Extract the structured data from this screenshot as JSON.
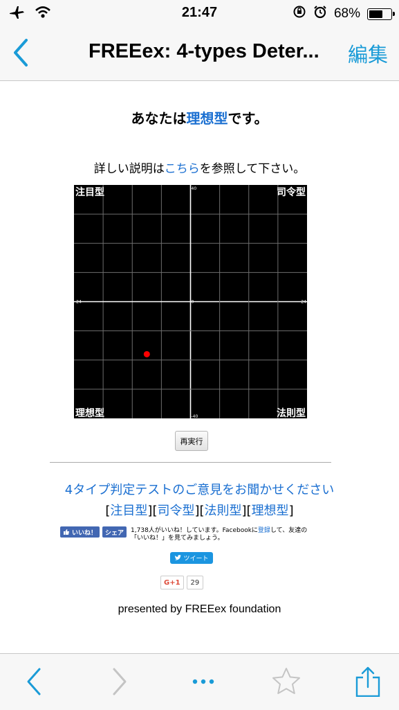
{
  "status_bar": {
    "time": "21:47",
    "battery_percent": "68%",
    "battery_level": 0.68,
    "icons": [
      "airplane-icon",
      "wifi-icon",
      "rotation-lock-icon",
      "alarm-icon",
      "battery-icon"
    ]
  },
  "nav": {
    "title": "FREEex: 4-types Deter...",
    "edit_label": "編集",
    "accent_color": "#1a9bd7"
  },
  "result": {
    "prefix": "あなたは",
    "type": "理想型",
    "suffix": "です。"
  },
  "detail": {
    "prefix": "詳しい説明は",
    "link": "こちら",
    "suffix": "を参照して下さい。"
  },
  "chart_data": {
    "type": "scatter",
    "quadrant_labels": {
      "top_left": "注目型",
      "top_right": "司令型",
      "bottom_left": "理想型",
      "bottom_right": "法則型"
    },
    "x_range": [
      -24,
      24
    ],
    "y_range": [
      -40,
      40
    ],
    "tick_labels": {
      "y_top": "40",
      "y_bottom": "-40",
      "x_left": "-24",
      "x_right": "24",
      "origin": "0"
    },
    "points": [
      {
        "x": -9,
        "y": -18,
        "color": "#ff0000"
      }
    ],
    "grid": true
  },
  "rerun_label": "再実行",
  "feedback_link": "4タイプ判定テストのご意見をお聞かせください",
  "type_links": [
    "注目型",
    "司令型",
    "法則型",
    "理想型"
  ],
  "social": {
    "like_label": "いいね！",
    "share_label": "シェア",
    "fb_text_1": "1,738人がいいね！しています。Facebookに",
    "fb_register": "登録",
    "fb_text_2": "して、友達の",
    "fb_text_3": "「いいね！」を見てみましょう。",
    "tweet_label": "ツイート",
    "gplus_label": "G+1",
    "gplus_count": "29"
  },
  "presented_by": "presented by FREEex foundation",
  "toolbar": {
    "icons": [
      "back-icon",
      "forward-icon",
      "more-icon",
      "favorite-icon",
      "share-icon"
    ]
  }
}
